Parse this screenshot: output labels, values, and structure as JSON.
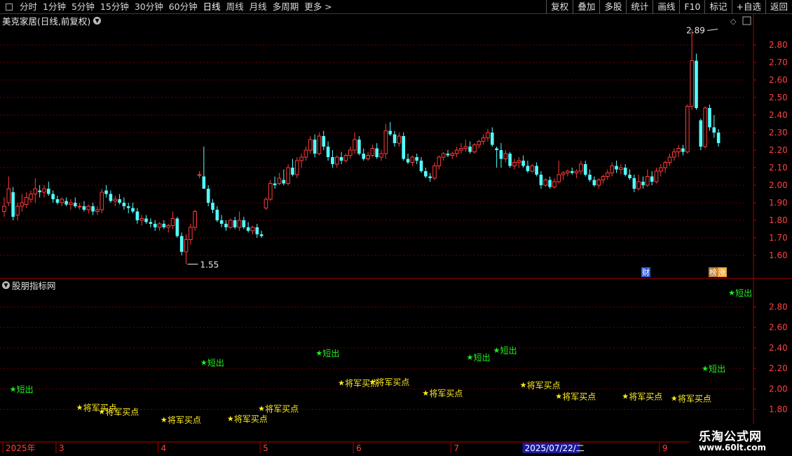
{
  "toolbar": {
    "periods": [
      "分时",
      "1分钟",
      "5分钟",
      "15分钟",
      "30分钟",
      "60分钟",
      "日线",
      "周线",
      "月线",
      "多周期",
      "更多 >"
    ],
    "active_period": "日线",
    "buttons": [
      "复权",
      "叠加",
      "多股",
      "统计",
      "画线",
      "F10",
      "标记",
      "+自选",
      "返回"
    ]
  },
  "main": {
    "title": "美克家居(日线,前复权)",
    "price_ticks": [
      "2.80",
      "2.70",
      "2.60",
      "2.50",
      "2.40",
      "2.30",
      "2.20",
      "2.10",
      "2.00",
      "1.90",
      "1.80",
      "1.70",
      "1.60"
    ],
    "high_label": "2.89",
    "low_label": "1.55",
    "badges": [
      {
        "text": "财",
        "color": "#2a5ed8"
      },
      {
        "text": "榜",
        "color": "#b87838"
      },
      {
        "text": "涨",
        "color": "#f0a030"
      }
    ]
  },
  "indicator": {
    "title": "股朋指标网",
    "ticks": [
      "2.80",
      "2.60",
      "2.40",
      "2.20",
      "2.00",
      "1.80"
    ],
    "signals": [
      {
        "type": "short",
        "label": "短出",
        "price": 2.0,
        "day": 2
      },
      {
        "type": "buy",
        "label": "将军买点",
        "price": 1.82,
        "day": 17
      },
      {
        "type": "buy",
        "label": "将军买点",
        "price": 1.78,
        "day": 22
      },
      {
        "type": "buy",
        "label": "将军买点",
        "price": 1.7,
        "day": 36
      },
      {
        "type": "short",
        "label": "短出",
        "price": 2.26,
        "day": 45
      },
      {
        "type": "buy",
        "label": "将军买点",
        "price": 1.71,
        "day": 51
      },
      {
        "type": "buy",
        "label": "将军买点",
        "price": 1.81,
        "day": 58
      },
      {
        "type": "short",
        "label": "短出",
        "price": 2.35,
        "day": 71
      },
      {
        "type": "buy",
        "label": "将军买点",
        "price": 2.06,
        "day": 76
      },
      {
        "type": "buy",
        "label": "将军买点",
        "price": 2.07,
        "day": 83
      },
      {
        "type": "buy",
        "label": "将军买点",
        "price": 1.96,
        "day": 95
      },
      {
        "type": "short",
        "label": "短出",
        "price": 2.31,
        "day": 105
      },
      {
        "type": "short",
        "label": "短出",
        "price": 2.38,
        "day": 111
      },
      {
        "type": "buy",
        "label": "将军买点",
        "price": 2.04,
        "day": 117
      },
      {
        "type": "buy",
        "label": "将军买点",
        "price": 1.93,
        "day": 125
      },
      {
        "type": "buy",
        "label": "将军买点",
        "price": 1.93,
        "day": 140
      },
      {
        "type": "buy",
        "label": "将军买点",
        "price": 1.91,
        "day": 151
      },
      {
        "type": "short",
        "label": "短出",
        "price": 2.2,
        "day": 158
      },
      {
        "type": "short",
        "label": "短出",
        "price": 2.94,
        "day": 164
      }
    ]
  },
  "date_axis": {
    "labels": [
      {
        "text": "2025年",
        "day": 0
      },
      {
        "text": "3",
        "day": 12
      },
      {
        "text": "4",
        "day": 35
      },
      {
        "text": "5",
        "day": 58
      },
      {
        "text": "6",
        "day": 79
      },
      {
        "text": "7",
        "day": 101
      },
      {
        "text": "2025/07/22/二",
        "day": 117,
        "highlight": true
      },
      {
        "text": "9",
        "day": 148
      }
    ]
  },
  "watermark": {
    "line1": "乐淘公式网",
    "line2": "www.60lt.com"
  },
  "colors": {
    "up": "#ff3b3b",
    "down": "#54ffff",
    "grid": "#6e0000",
    "axis": "#b00000",
    "tick": "#ff4040",
    "short": "#22ee22",
    "buy": "#ffee22"
  },
  "chart_data": {
    "type": "candlestick",
    "title": "美克家居(日线,前复权)",
    "y_axis_ticks": [
      1.6,
      1.7,
      1.8,
      1.9,
      2.0,
      2.1,
      2.2,
      2.3,
      2.4,
      2.5,
      2.6,
      2.7,
      2.8
    ],
    "ylim": [
      1.53,
      2.95
    ],
    "annotations": [
      {
        "text": "2.89",
        "type": "high"
      },
      {
        "text": "1.55",
        "type": "low"
      }
    ],
    "ohlc": [
      [
        1.85,
        1.93,
        1.82,
        1.88
      ],
      [
        1.9,
        2.05,
        1.88,
        1.98
      ],
      [
        1.96,
        1.99,
        1.8,
        1.82
      ],
      [
        1.83,
        1.9,
        1.8,
        1.88
      ],
      [
        1.88,
        1.95,
        1.85,
        1.9
      ],
      [
        1.89,
        1.96,
        1.87,
        1.93
      ],
      [
        1.92,
        1.97,
        1.9,
        1.95
      ],
      [
        1.95,
        2.04,
        1.9,
        1.98
      ],
      [
        1.97,
        2.0,
        1.93,
        1.96
      ],
      [
        1.96,
        2.0,
        1.93,
        1.98
      ],
      [
        1.98,
        2.02,
        1.94,
        1.95
      ],
      [
        1.95,
        1.97,
        1.9,
        1.92
      ],
      [
        1.92,
        1.94,
        1.89,
        1.9
      ],
      [
        1.9,
        1.93,
        1.88,
        1.92
      ],
      [
        1.91,
        1.93,
        1.88,
        1.89
      ],
      [
        1.89,
        1.92,
        1.86,
        1.9
      ],
      [
        1.9,
        1.93,
        1.87,
        1.88
      ],
      [
        1.88,
        1.9,
        1.86,
        1.88
      ],
      [
        1.88,
        1.91,
        1.85,
        1.86
      ],
      [
        1.86,
        1.89,
        1.84,
        1.88
      ],
      [
        1.88,
        1.9,
        1.83,
        1.85
      ],
      [
        1.85,
        1.88,
        1.83,
        1.86
      ],
      [
        1.86,
        1.98,
        1.84,
        1.96
      ],
      [
        1.97,
        2.0,
        1.93,
        1.95
      ],
      [
        1.95,
        1.97,
        1.9,
        1.91
      ],
      [
        1.91,
        1.94,
        1.88,
        1.92
      ],
      [
        1.92,
        1.95,
        1.89,
        1.9
      ],
      [
        1.9,
        1.93,
        1.86,
        1.88
      ],
      [
        1.88,
        1.9,
        1.84,
        1.87
      ],
      [
        1.87,
        1.9,
        1.84,
        1.85
      ],
      [
        1.85,
        1.87,
        1.78,
        1.8
      ],
      [
        1.8,
        1.83,
        1.77,
        1.81
      ],
      [
        1.81,
        1.83,
        1.78,
        1.79
      ],
      [
        1.79,
        1.81,
        1.76,
        1.78
      ],
      [
        1.78,
        1.8,
        1.74,
        1.76
      ],
      [
        1.76,
        1.79,
        1.74,
        1.78
      ],
      [
        1.78,
        1.8,
        1.75,
        1.76
      ],
      [
        1.76,
        1.78,
        1.73,
        1.77
      ],
      [
        1.77,
        1.85,
        1.75,
        1.81
      ],
      [
        1.81,
        1.82,
        1.7,
        1.71
      ],
      [
        1.71,
        1.73,
        1.6,
        1.62
      ],
      [
        1.62,
        1.72,
        1.55,
        1.69
      ],
      [
        1.69,
        1.78,
        1.66,
        1.76
      ],
      [
        1.76,
        1.86,
        1.74,
        1.85
      ],
      [
        2.06,
        2.08,
        2.04,
        2.06
      ],
      [
        2.05,
        2.22,
        2.0,
        1.98
      ],
      [
        1.98,
        2.0,
        1.88,
        1.9
      ],
      [
        1.9,
        1.92,
        1.84,
        1.86
      ],
      [
        1.86,
        1.88,
        1.79,
        1.8
      ],
      [
        1.8,
        1.83,
        1.76,
        1.78
      ],
      [
        1.78,
        1.8,
        1.74,
        1.76
      ],
      [
        1.76,
        1.81,
        1.75,
        1.8
      ],
      [
        1.8,
        1.82,
        1.75,
        1.76
      ],
      [
        1.76,
        1.85,
        1.74,
        1.8
      ],
      [
        1.8,
        1.82,
        1.75,
        1.76
      ],
      [
        1.76,
        1.79,
        1.73,
        1.74
      ],
      [
        1.74,
        1.77,
        1.72,
        1.76
      ],
      [
        1.76,
        1.78,
        1.7,
        1.72
      ],
      [
        1.72,
        1.74,
        1.7,
        1.71
      ],
      [
        1.87,
        1.93,
        1.86,
        1.92
      ],
      [
        1.92,
        2.03,
        1.91,
        2.01
      ],
      [
        2.01,
        2.05,
        1.98,
        2.0
      ],
      [
        2.01,
        2.07,
        2.0,
        2.04
      ],
      [
        2.03,
        2.09,
        2.0,
        2.01
      ],
      [
        2.01,
        2.12,
        2.0,
        2.1
      ],
      [
        2.1,
        2.15,
        2.05,
        2.06
      ],
      [
        2.06,
        2.16,
        2.04,
        2.14
      ],
      [
        2.14,
        2.18,
        2.1,
        2.16
      ],
      [
        2.16,
        2.22,
        2.14,
        2.2
      ],
      [
        2.2,
        2.28,
        2.18,
        2.26
      ],
      [
        2.26,
        2.29,
        2.16,
        2.18
      ],
      [
        2.18,
        2.3,
        2.17,
        2.28
      ],
      [
        2.28,
        2.31,
        2.2,
        2.22
      ],
      [
        2.22,
        2.25,
        2.14,
        2.16
      ],
      [
        2.16,
        2.2,
        2.1,
        2.12
      ],
      [
        2.12,
        2.17,
        2.1,
        2.16
      ],
      [
        2.16,
        2.19,
        2.12,
        2.14
      ],
      [
        2.14,
        2.18,
        2.13,
        2.17
      ],
      [
        2.17,
        2.22,
        2.15,
        2.2
      ],
      [
        2.2,
        2.3,
        2.18,
        2.26
      ],
      [
        2.26,
        2.28,
        2.17,
        2.18
      ],
      [
        2.18,
        2.21,
        2.14,
        2.15
      ],
      [
        2.15,
        2.19,
        2.14,
        2.17
      ],
      [
        2.17,
        2.23,
        2.16,
        2.21
      ],
      [
        2.21,
        2.24,
        2.15,
        2.16
      ],
      [
        2.16,
        2.2,
        2.14,
        2.18
      ],
      [
        2.18,
        2.35,
        2.15,
        2.31
      ],
      [
        2.31,
        2.36,
        2.28,
        2.29
      ],
      [
        2.29,
        2.31,
        2.22,
        2.24
      ],
      [
        2.24,
        2.3,
        2.22,
        2.28
      ],
      [
        2.28,
        2.3,
        2.14,
        2.15
      ],
      [
        2.15,
        2.18,
        2.12,
        2.13
      ],
      [
        2.13,
        2.17,
        2.11,
        2.16
      ],
      [
        2.16,
        2.18,
        2.12,
        2.14
      ],
      [
        2.14,
        2.16,
        2.07,
        2.08
      ],
      [
        2.08,
        2.1,
        2.04,
        2.05
      ],
      [
        2.05,
        2.07,
        2.02,
        2.04
      ],
      [
        2.04,
        2.13,
        2.03,
        2.11
      ],
      [
        2.11,
        2.17,
        2.09,
        2.16
      ],
      [
        2.16,
        2.19,
        2.14,
        2.18
      ],
      [
        2.18,
        2.2,
        2.16,
        2.17
      ],
      [
        2.17,
        2.19,
        2.15,
        2.18
      ],
      [
        2.18,
        2.22,
        2.16,
        2.2
      ],
      [
        2.2,
        2.24,
        2.18,
        2.21
      ],
      [
        2.21,
        2.26,
        2.19,
        2.22
      ],
      [
        2.22,
        2.25,
        2.18,
        2.19
      ],
      [
        2.19,
        2.24,
        2.18,
        2.23
      ],
      [
        2.23,
        2.26,
        2.21,
        2.25
      ],
      [
        2.25,
        2.29,
        2.23,
        2.27
      ],
      [
        2.27,
        2.32,
        2.25,
        2.3
      ],
      [
        2.3,
        2.33,
        2.22,
        2.23
      ],
      [
        2.21,
        2.22,
        2.1,
        2.2
      ],
      [
        2.2,
        2.24,
        2.1,
        2.15
      ],
      [
        2.15,
        2.2,
        2.13,
        2.18
      ],
      [
        2.18,
        2.19,
        2.1,
        2.11
      ],
      [
        2.11,
        2.15,
        2.09,
        2.13
      ],
      [
        2.13,
        2.16,
        2.1,
        2.14
      ],
      [
        2.14,
        2.17,
        2.1,
        2.11
      ],
      [
        2.11,
        2.14,
        2.07,
        2.08
      ],
      [
        2.08,
        2.12,
        2.07,
        2.11
      ],
      [
        2.11,
        2.13,
        2.05,
        2.06
      ],
      [
        2.06,
        2.08,
        1.98,
        2.0
      ],
      [
        2.0,
        2.04,
        1.99,
        2.03
      ],
      [
        2.03,
        2.05,
        1.98,
        1.99
      ],
      [
        1.99,
        2.04,
        1.98,
        2.02
      ],
      [
        2.02,
        2.14,
        2.01,
        2.06
      ],
      [
        2.06,
        2.08,
        2.03,
        2.07
      ],
      [
        2.07,
        2.09,
        2.05,
        2.08
      ],
      [
        2.08,
        2.1,
        2.06,
        2.07
      ],
      [
        2.07,
        2.09,
        2.04,
        2.08
      ],
      [
        2.08,
        2.14,
        2.06,
        2.12
      ],
      [
        2.12,
        2.14,
        2.05,
        2.06
      ],
      [
        2.06,
        2.09,
        2.02,
        2.03
      ],
      [
        2.03,
        2.05,
        1.99,
        2.0
      ],
      [
        2.0,
        2.04,
        1.98,
        2.03
      ],
      [
        2.03,
        2.06,
        2.01,
        2.05
      ],
      [
        2.05,
        2.09,
        2.03,
        2.07
      ],
      [
        2.07,
        2.13,
        2.05,
        2.11
      ],
      [
        2.11,
        2.14,
        2.07,
        2.09
      ],
      [
        2.09,
        2.12,
        2.06,
        2.1
      ],
      [
        2.1,
        2.12,
        2.05,
        2.06
      ],
      [
        2.06,
        2.09,
        2.03,
        2.04
      ],
      [
        2.04,
        2.06,
        1.96,
        1.98
      ],
      [
        1.98,
        2.06,
        1.97,
        2.02
      ],
      [
        2.02,
        2.05,
        1.98,
        2.0
      ],
      [
        2.0,
        2.09,
        1.99,
        2.05
      ],
      [
        2.05,
        2.08,
        2.0,
        2.02
      ],
      [
        2.02,
        2.1,
        2.01,
        2.08
      ],
      [
        2.08,
        2.12,
        2.05,
        2.1
      ],
      [
        2.1,
        2.14,
        2.07,
        2.13
      ],
      [
        2.13,
        2.18,
        2.11,
        2.16
      ],
      [
        2.16,
        2.21,
        2.14,
        2.19
      ],
      [
        2.19,
        2.23,
        2.16,
        2.21
      ],
      [
        2.21,
        2.23,
        2.17,
        2.19
      ],
      [
        2.19,
        2.46,
        2.18,
        2.45
      ],
      [
        2.45,
        2.89,
        2.43,
        2.71
      ],
      [
        2.71,
        2.75,
        2.43,
        2.44
      ],
      [
        2.37,
        2.38,
        2.2,
        2.22
      ],
      [
        2.22,
        2.45,
        2.21,
        2.44
      ],
      [
        2.44,
        2.46,
        2.31,
        2.33
      ],
      [
        2.33,
        2.4,
        2.27,
        2.3
      ],
      [
        2.3,
        2.32,
        2.22,
        2.24
      ]
    ]
  }
}
